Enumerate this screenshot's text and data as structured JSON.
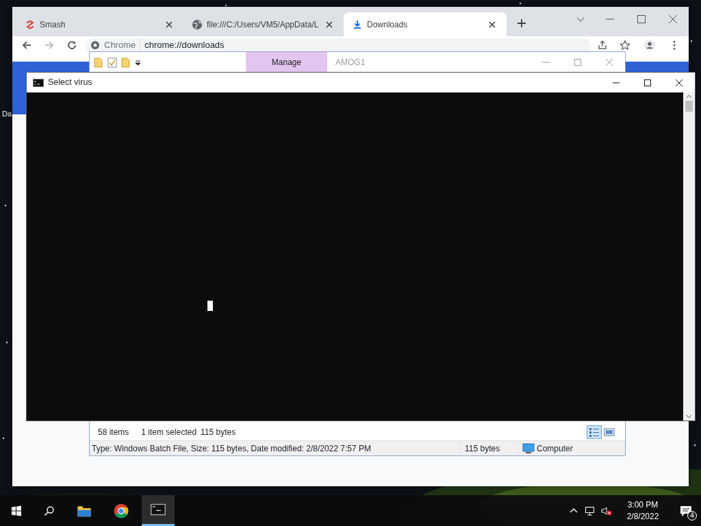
{
  "desktop": {
    "icon_labels": [
      "Da"
    ]
  },
  "browser": {
    "tabs": [
      {
        "title": "Smash",
        "selected": false
      },
      {
        "title": "file:///C:/Users/VM5/AppData/L",
        "selected": false
      },
      {
        "title": "Downloads",
        "selected": true
      }
    ],
    "forward_disabled": true,
    "address": {
      "site": "Chrome",
      "url": "chrome://downloads"
    }
  },
  "explorer": {
    "ribbon_tab": "Manage",
    "title": "AMOG1",
    "status": {
      "items": "58 items",
      "selected": "1 item selected",
      "size": "115 bytes"
    },
    "details": {
      "info": "Type: Windows Batch File, Size: 115 bytes, Date modified: 2/8/2022 7:57 PM",
      "size": "115 bytes",
      "location": "Computer"
    }
  },
  "console": {
    "title": "Select virus"
  },
  "taskbar": {
    "apps": [
      {
        "kind": "explorer",
        "active": false
      },
      {
        "kind": "chrome",
        "active": false
      },
      {
        "kind": "console",
        "active": true
      }
    ],
    "volume_muted": true,
    "time": "3:00 PM",
    "date": "2/8/2022",
    "notifications": "4"
  }
}
